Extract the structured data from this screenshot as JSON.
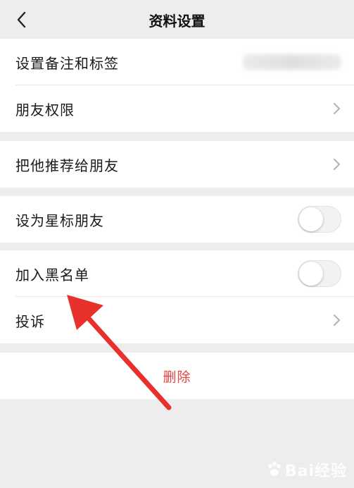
{
  "header": {
    "title": "资料设置",
    "back_icon": "chevron-left-icon"
  },
  "group1": {
    "items": [
      {
        "label": "设置备注和标签",
        "value_blurred": ""
      },
      {
        "label": "朋友权限"
      }
    ]
  },
  "group2": {
    "items": [
      {
        "label": "把他推荐给朋友"
      }
    ]
  },
  "group3": {
    "items": [
      {
        "label": "设为星标朋友",
        "toggle": false
      }
    ]
  },
  "group4": {
    "items": [
      {
        "label": "加入黑名单",
        "toggle": false
      },
      {
        "label": "投诉"
      }
    ]
  },
  "delete": {
    "label": "删除"
  },
  "watermark": {
    "text": "Bai经验"
  },
  "colors": {
    "background": "#ededed",
    "cell": "#ffffff",
    "danger": "#e64340",
    "annotation_arrow": "#e8302c"
  }
}
